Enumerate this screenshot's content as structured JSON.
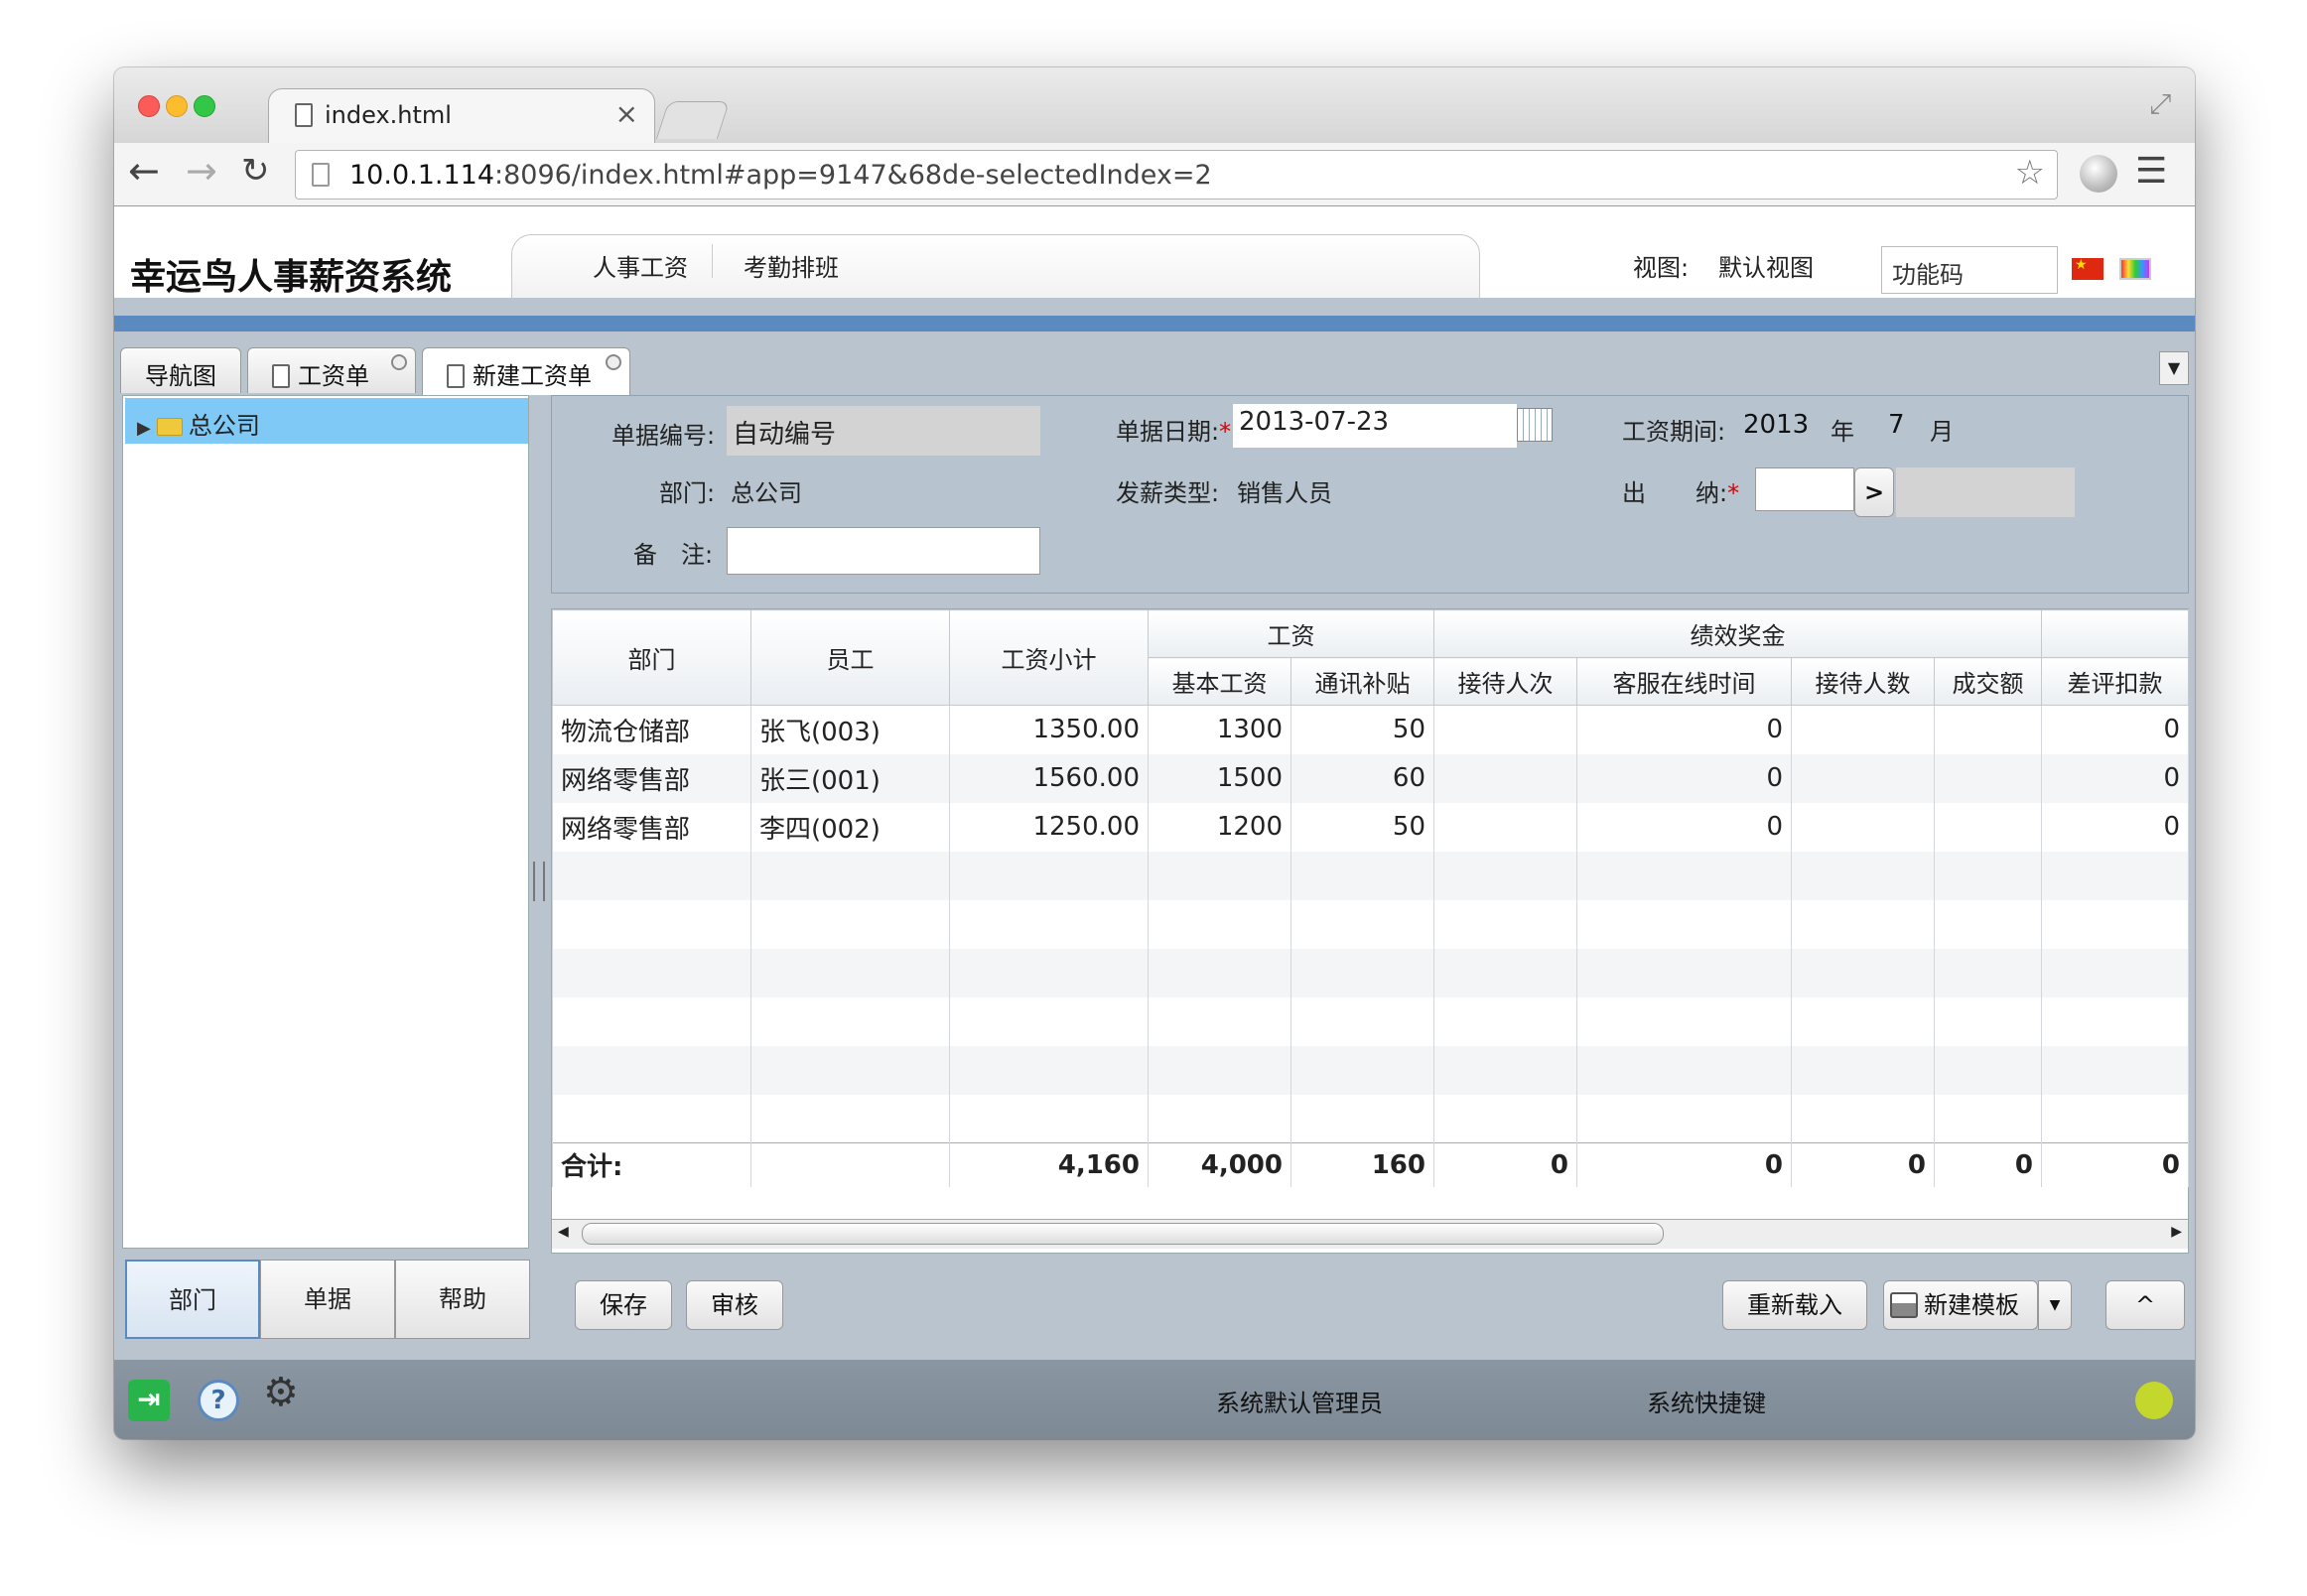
{
  "browser": {
    "tab_title": "index.html",
    "url_host": "10.0.1.114",
    "url_rest": ":8096/index.html#app=9147&68de-selectedIndex=2"
  },
  "app": {
    "title": "幸运鸟人事薪资系统",
    "menu": [
      "人事工资",
      "考勤排班"
    ],
    "view_label": "视图:",
    "view_value": "默认视图",
    "func_placeholder": "功能码"
  },
  "tabs": [
    "导航图",
    "工资单",
    "新建工资单"
  ],
  "tree": {
    "root": "总公司"
  },
  "left_buttons": [
    "部门",
    "单据",
    "帮助"
  ],
  "form": {
    "doc_no_label": "单据编号:",
    "doc_no_value": "自动编号",
    "date_label": "单据日期:",
    "date_value": "2013-07-23",
    "period_label": "工资期间:",
    "period_year": "2013",
    "year_unit": "年",
    "period_month": "7",
    "month_unit": "月",
    "dept_label": "部门:",
    "dept_value": "总公司",
    "paytype_label": "发薪类型:",
    "paytype_value": "销售人员",
    "cashier_label_1": "出",
    "cashier_label_2": "纳:",
    "cashier_btn": ">",
    "remark_label_1": "备",
    "remark_label_2": "注:",
    "required_mark": "*"
  },
  "grid": {
    "group_headers": {
      "salary": "工资",
      "bonus": "绩效奖金"
    },
    "headers": {
      "dept": "部门",
      "emp": "员工",
      "subtotal": "工资小计",
      "base": "基本工资",
      "comm": "通讯补贴",
      "recv_times": "接待人次",
      "online_time": "客服在线时间",
      "recv_count": "接待人数",
      "deal": "成交额",
      "penalty": "差评扣款"
    },
    "rows": [
      {
        "dept": "物流仓储部",
        "emp": "张飞(003)",
        "subtotal": "1350.00",
        "base": "1300",
        "comm": "50",
        "recv_times": "",
        "online_time": "0",
        "recv_count": "",
        "deal": "",
        "penalty": "0"
      },
      {
        "dept": "网络零售部",
        "emp": "张三(001)",
        "subtotal": "1560.00",
        "base": "1500",
        "comm": "60",
        "recv_times": "",
        "online_time": "0",
        "recv_count": "",
        "deal": "",
        "penalty": "0"
      },
      {
        "dept": "网络零售部",
        "emp": "李四(002)",
        "subtotal": "1250.00",
        "base": "1200",
        "comm": "50",
        "recv_times": "",
        "online_time": "0",
        "recv_count": "",
        "deal": "",
        "penalty": "0"
      }
    ],
    "totals": {
      "label": "合计:",
      "subtotal": "4,160",
      "base": "4,000",
      "comm": "160",
      "recv_times": "0",
      "online_time": "0",
      "recv_count": "0",
      "deal": "0",
      "penalty": "0"
    }
  },
  "actions": {
    "save": "保存",
    "audit": "审核",
    "reload": "重新载入",
    "new_template": "新建模板",
    "dropdown": "▼",
    "collapse": "^"
  },
  "status": {
    "user": "系统默认管理员",
    "shortcut": "系统快捷键"
  },
  "colors": {
    "accent": "#5b8ac1",
    "tree_selected": "#7ec9f6",
    "status_dot": "#c4d72c"
  }
}
